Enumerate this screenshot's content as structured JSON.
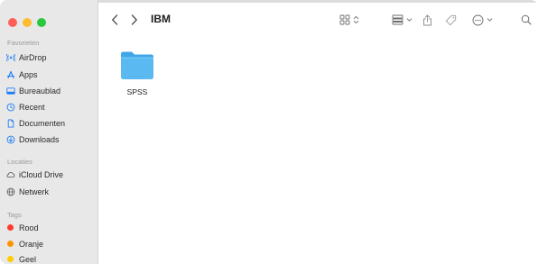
{
  "window": {
    "title": "IBM"
  },
  "sidebar": {
    "favorites_label": "Favorieten",
    "favorites": [
      {
        "label": "AirDrop",
        "icon": "airdrop-icon"
      },
      {
        "label": "Apps",
        "icon": "apps-icon"
      },
      {
        "label": "Bureaublad",
        "icon": "desktop-icon"
      },
      {
        "label": "Recent",
        "icon": "clock-icon"
      },
      {
        "label": "Documenten",
        "icon": "document-icon"
      },
      {
        "label": "Downloads",
        "icon": "download-icon"
      }
    ],
    "locations_label": "Locaties",
    "locations": [
      {
        "label": "iCloud Drive",
        "icon": "cloud-icon"
      },
      {
        "label": "Netwerk",
        "icon": "network-icon"
      }
    ],
    "tags_label": "Tags",
    "tags": [
      {
        "label": "Rood",
        "color": "#ff3b30"
      },
      {
        "label": "Oranje",
        "color": "#ff9500"
      },
      {
        "label": "Geel",
        "color": "#ffcc00"
      }
    ]
  },
  "content": {
    "items": [
      {
        "name": "SPSS",
        "type": "folder"
      }
    ]
  },
  "colors": {
    "accent": "#1b7cf6",
    "folder": "#5ab9f0",
    "sidebar_bg": "#e9e8e8"
  }
}
